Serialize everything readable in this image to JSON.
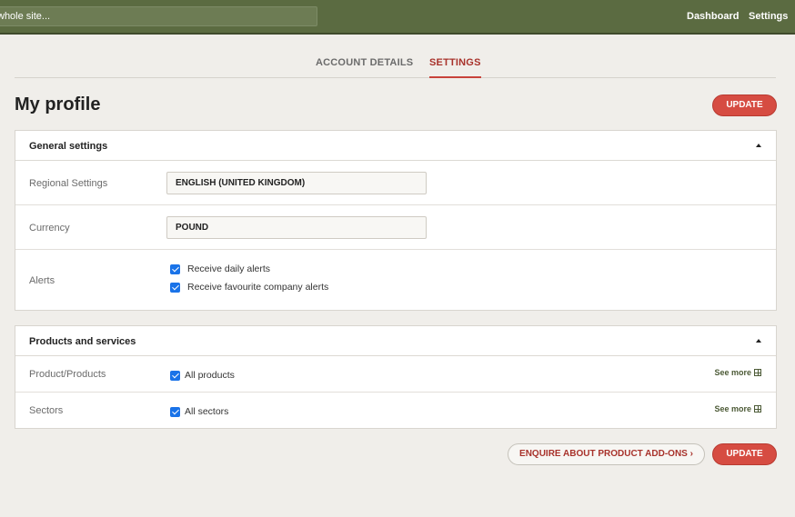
{
  "header": {
    "search_text": "whole site...",
    "nav": {
      "dashboard": "Dashboard",
      "settings": "Settings"
    }
  },
  "tabs": [
    {
      "label": "ACCOUNT DETAILS",
      "active": false
    },
    {
      "label": "SETTINGS",
      "active": true
    }
  ],
  "page": {
    "title": "My profile",
    "update_label": "UPDATE"
  },
  "general": {
    "title": "General settings",
    "regional_label": "Regional Settings",
    "regional_value": "ENGLISH (UNITED KINGDOM)",
    "currency_label": "Currency",
    "currency_value": "POUND",
    "alerts_label": "Alerts",
    "alerts": [
      {
        "label": "Receive daily alerts",
        "checked": true
      },
      {
        "label": "Receive favourite company alerts",
        "checked": true
      }
    ]
  },
  "products": {
    "title": "Products and services",
    "rows": [
      {
        "label": "Product/Products",
        "check_label": "All products",
        "checked": true,
        "see_more": "See more"
      },
      {
        "label": "Sectors",
        "check_label": "All sectors",
        "checked": true,
        "see_more": "See more"
      }
    ]
  },
  "footer": {
    "enquire_label": "ENQUIRE ABOUT PRODUCT ADD-ONS ›",
    "update_label": "UPDATE"
  },
  "colors": {
    "topbar": "#5b6b41",
    "accent_red": "#d64c42",
    "active_tab": "#a8322b",
    "checkbox": "#1a73e8"
  }
}
